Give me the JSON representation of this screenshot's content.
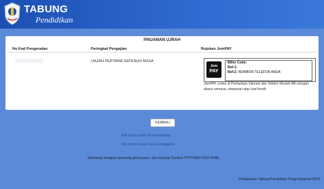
{
  "brand": {
    "title": "TABUNG",
    "subtitle": "Pendidikan"
  },
  "section_title": "PINJAMAN UJRAH",
  "columns": [
    "No Kad Pengenalan",
    "Peringkat Pengajian",
    "Rujukan JomPAY"
  ],
  "row": {
    "level": "IJAZAH PERTAMA SEPENUH MASA"
  },
  "jompay": {
    "logo_top": "Jom",
    "logo_bottom": "PAY",
    "biller_label": "Biller Code:",
    "ref1_label": "Ref-1:",
    "ref2_label": "Ref-2:",
    "ref2_value": "NOMBOR TELEFON ANDA",
    "description": "JomPAY online di Perbankan Internet dan Telefon Mudah Alih dengan akaun semasa, simpanan atau kad kredit"
  },
  "buttons": {
    "back": "KEMBALI"
  },
  "links": {
    "banks": "Klik di sini untuk 40 bank terlibat.",
    "manual": "Klik di sini untuk manual pengguna."
  },
  "info_text": "Sekiranya terdapat sebarang pertanyaan, sila hubungi Careline PTPTN(03-2193 3000).",
  "footer": {
    "text": "Perbadanan Tabung Pendidikan Tinggi Nasional 2019"
  },
  "colors": {
    "header": "#1c4fb4",
    "background": "#5b8ad8",
    "card": "#ffffff"
  }
}
